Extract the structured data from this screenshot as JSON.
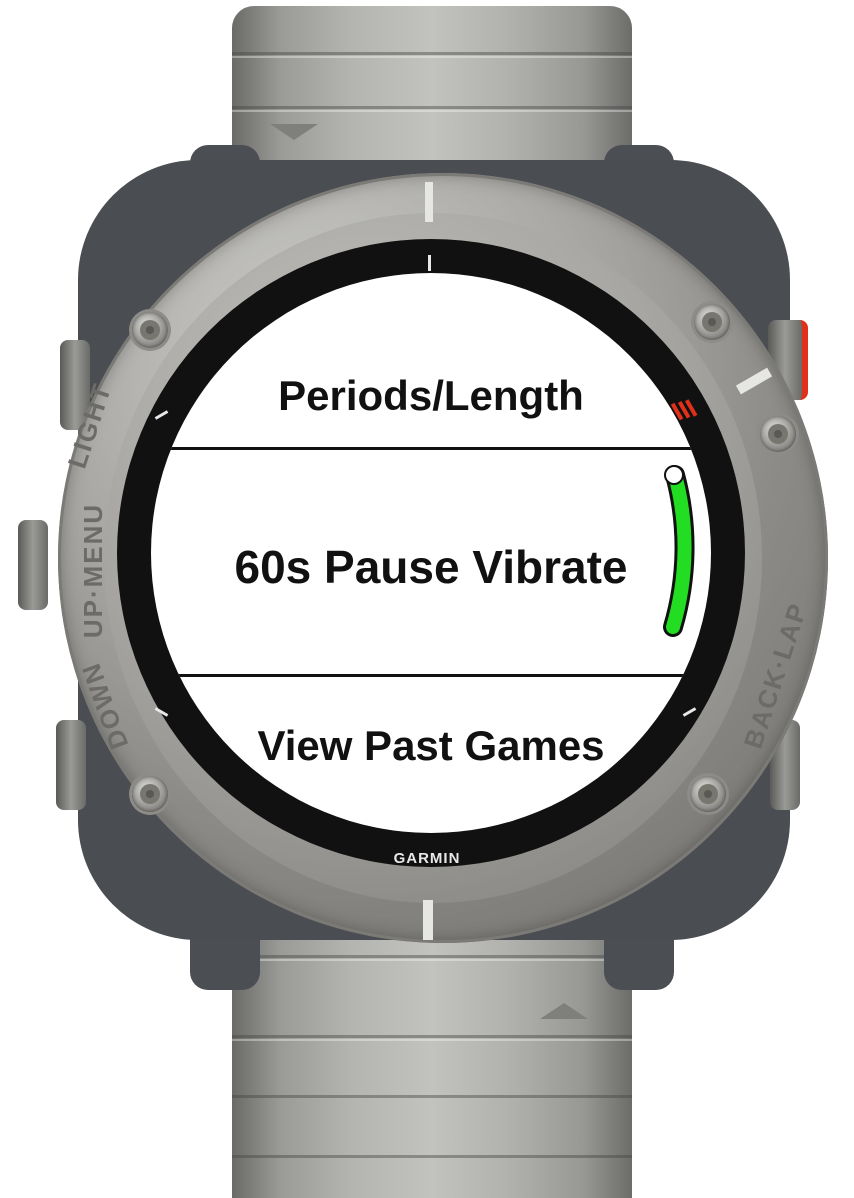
{
  "watch": {
    "brand": "GARMIN",
    "button_labels": {
      "light": "LIGHT",
      "up_menu": "UP·MENU",
      "down": "DOWN",
      "back_lap": "BACK·LAP"
    }
  },
  "menu": {
    "items": [
      {
        "label": "Periods/Length"
      },
      {
        "label": "60s Pause Vibrate",
        "selected": true
      },
      {
        "label": "View Past Games"
      }
    ],
    "scroll_position": 0.5
  },
  "colors": {
    "scroll_indicator": "#22dd22",
    "accent_red": "#e0301a",
    "screen_background": "#ffffff",
    "text": "#111111"
  }
}
